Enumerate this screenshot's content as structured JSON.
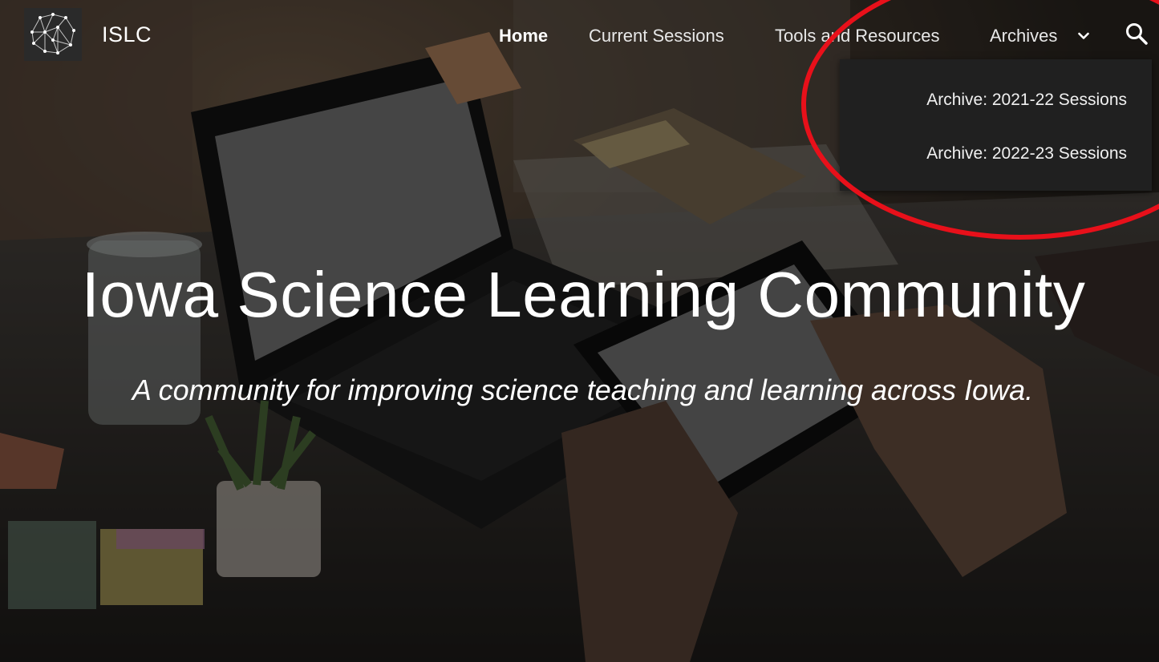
{
  "header": {
    "site_name": "ISLC",
    "logo_icon": "brain-network-icon"
  },
  "nav": {
    "items": [
      {
        "label": "Home",
        "active": true
      },
      {
        "label": "Current Sessions"
      },
      {
        "label": "Tools and Resources"
      },
      {
        "label": "Archives"
      }
    ],
    "archives_chevron_icon": "chevron-down-icon",
    "search_icon": "search-icon"
  },
  "dropdown": {
    "items": [
      {
        "label": "Archive: 2021-22 Sessions"
      },
      {
        "label": "Archive: 2022-23 Sessions"
      }
    ]
  },
  "hero": {
    "title": "Iowa Science Learning Community",
    "subtitle": "A community for improving science teaching and learning across Iowa."
  },
  "annotation": {
    "color": "#e8101a"
  },
  "colors": {
    "dropdown_bg": "#202020",
    "text": "#ffffff"
  }
}
